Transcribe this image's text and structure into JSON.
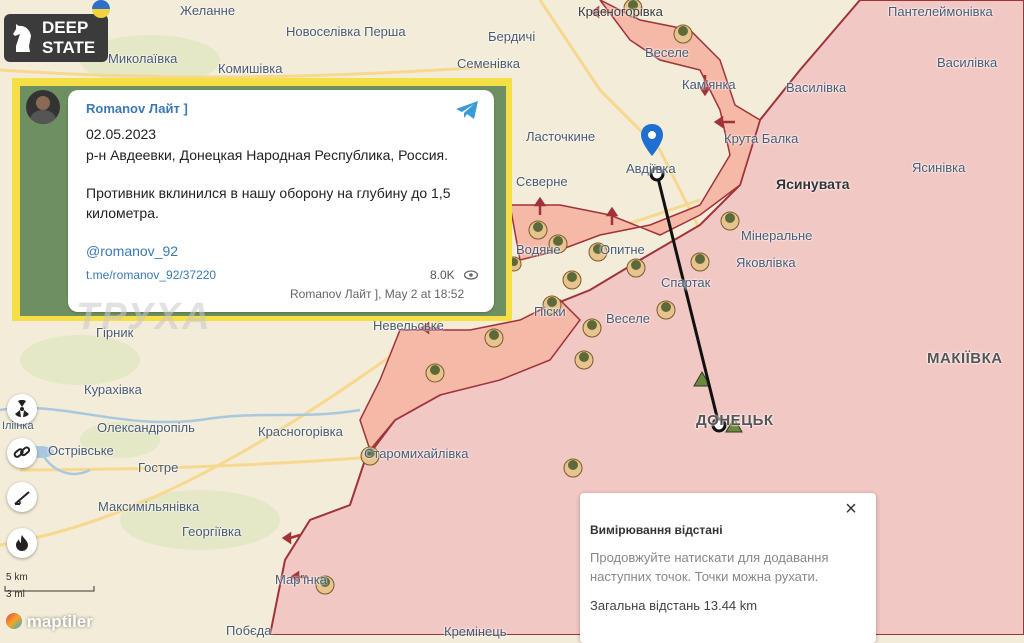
{
  "brand": {
    "name": "DEEP STATE",
    "line1": "DEEP",
    "line2": "STATE"
  },
  "colors": {
    "occupied": "#f2c8c5",
    "contested": "#f5b9a8",
    "frontline": "#a0333a",
    "free": "#f3ecd8",
    "water": "#a9c8e0",
    "post_frame": "#f5de46",
    "accent": "#3a79b5"
  },
  "towns": [
    {
      "name": "Желанне"
    },
    {
      "name": "Новоселівка Перша"
    },
    {
      "name": "Бердичі"
    },
    {
      "name": "Миколаївка"
    },
    {
      "name": "Семенівка"
    },
    {
      "name": "Комишівка"
    },
    {
      "name": "Красногорівка"
    },
    {
      "name": "Веселе"
    },
    {
      "name": "Пантелеймонівка"
    },
    {
      "name": "Василівка"
    },
    {
      "name": "Кам'янка"
    },
    {
      "name": "Ласточкине"
    },
    {
      "name": "Авдіївка"
    },
    {
      "name": "Крута Балка"
    },
    {
      "name": "Ясинувата"
    },
    {
      "name": "Ясинівка"
    },
    {
      "name": "Сєверне"
    },
    {
      "name": "Мінеральне"
    },
    {
      "name": "Водяне"
    },
    {
      "name": "Опитне"
    },
    {
      "name": "Яковлівка"
    },
    {
      "name": "Спартак"
    },
    {
      "name": "Піски"
    },
    {
      "name": "Веселе"
    },
    {
      "name": "Невельське"
    },
    {
      "name": "Гірник"
    },
    {
      "name": "МАКІЇВКА"
    },
    {
      "name": "Курахівка"
    },
    {
      "name": "ДОНЕЦЬК"
    },
    {
      "name": "Іліінка"
    },
    {
      "name": "Олександропіль"
    },
    {
      "name": "Красногорівка"
    },
    {
      "name": "Острівське"
    },
    {
      "name": "Старомихайлівка"
    },
    {
      "name": "Гостре"
    },
    {
      "name": "Максимільянівка"
    },
    {
      "name": "Георгіївка"
    },
    {
      "name": "Мар'їнка"
    },
    {
      "name": "Побєда"
    },
    {
      "name": "Кремінець"
    }
  ],
  "post": {
    "author": "Romanov Лайт ]",
    "date": "02.05.2023",
    "location": "р-н Авдеевки, Донецкая Народная Республика, Россия.",
    "body": "Противник вклинился в нашу оборону на глубину до 1,5 километра.",
    "handle": "@romanov_92",
    "link": "t.me/romanov_92/37220",
    "views": "8.0K",
    "footer": "Romanov Лайт ], May 2 at 18:52"
  },
  "watermark": "ТРУХА",
  "tools": [
    {
      "name": "radiation-icon"
    },
    {
      "name": "link-icon"
    },
    {
      "name": "measure-icon"
    },
    {
      "name": "fire-icon"
    }
  ],
  "scale": {
    "km": "5 km",
    "mi": "3 mi"
  },
  "attribution": "maptiler",
  "distance": {
    "title": "Вимірювання відстані",
    "hint": "Продовжуйте натискати для додавання наступних точок. Точки можна рухати.",
    "total": "Загальна відстань 13.44 km",
    "close": "×"
  }
}
